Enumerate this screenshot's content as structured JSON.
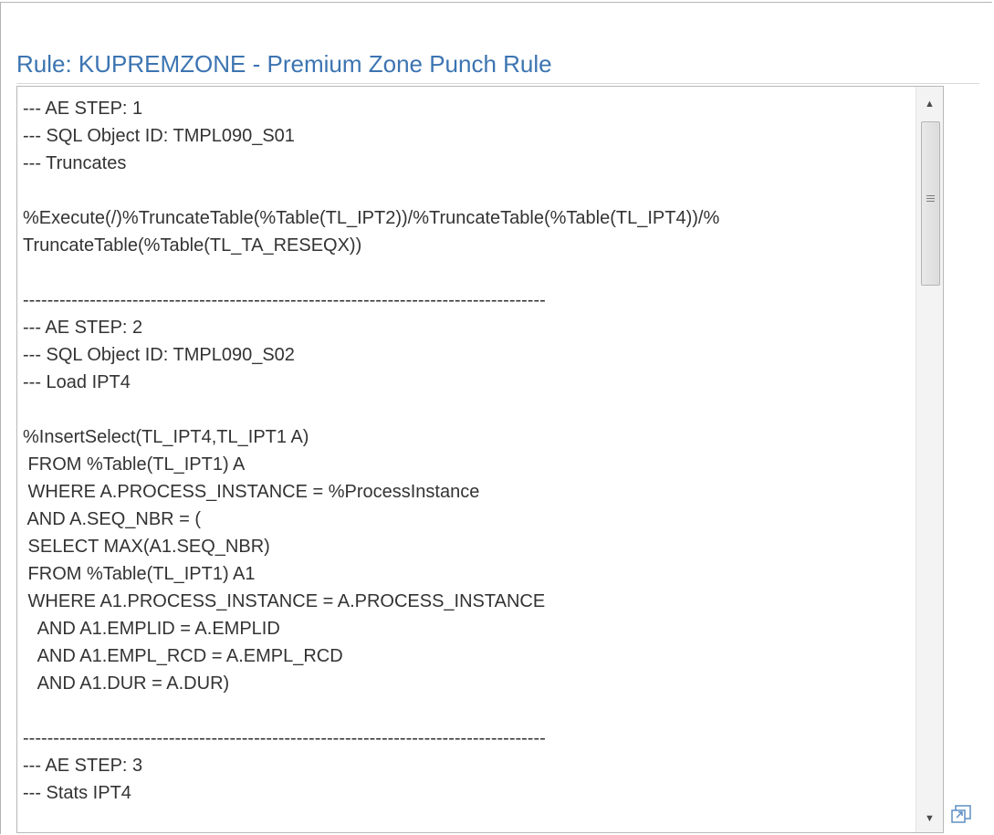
{
  "page_title": "Rule: KUPREMZONE - Premium Zone Punch Rule",
  "rule_text": "--- AE STEP: 1\n--- SQL Object ID: TMPL090_S01\n--- Truncates\n\n%Execute(/)%TruncateTable(%Table(TL_IPT2))/%TruncateTable(%Table(TL_IPT4))/%\nTruncateTable(%Table(TL_TA_RESEQX))\n\n--------------------------------------------------------------------------------------\n--- AE STEP: 2\n--- SQL Object ID: TMPL090_S02\n--- Load IPT4\n\n%InsertSelect(TL_IPT4,TL_IPT1 A)\n FROM %Table(TL_IPT1) A\n WHERE A.PROCESS_INSTANCE = %ProcessInstance\n AND A.SEQ_NBR = (\n SELECT MAX(A1.SEQ_NBR)\n FROM %Table(TL_IPT1) A1\n WHERE A1.PROCESS_INSTANCE = A.PROCESS_INSTANCE\n   AND A1.EMPLID = A.EMPLID\n   AND A1.EMPL_RCD = A.EMPL_RCD\n   AND A1.DUR = A.DUR)\n\n--------------------------------------------------------------------------------------\n--- AE STEP: 3\n--- Stats IPT4",
  "icons": {
    "scroll_up": "scroll-up-arrow-icon",
    "scroll_down": "scroll-down-arrow-icon",
    "expand": "expand-window-icon"
  },
  "colors": {
    "title": "#3c74b1",
    "text": "#333333",
    "border": "#b8b8b8"
  }
}
